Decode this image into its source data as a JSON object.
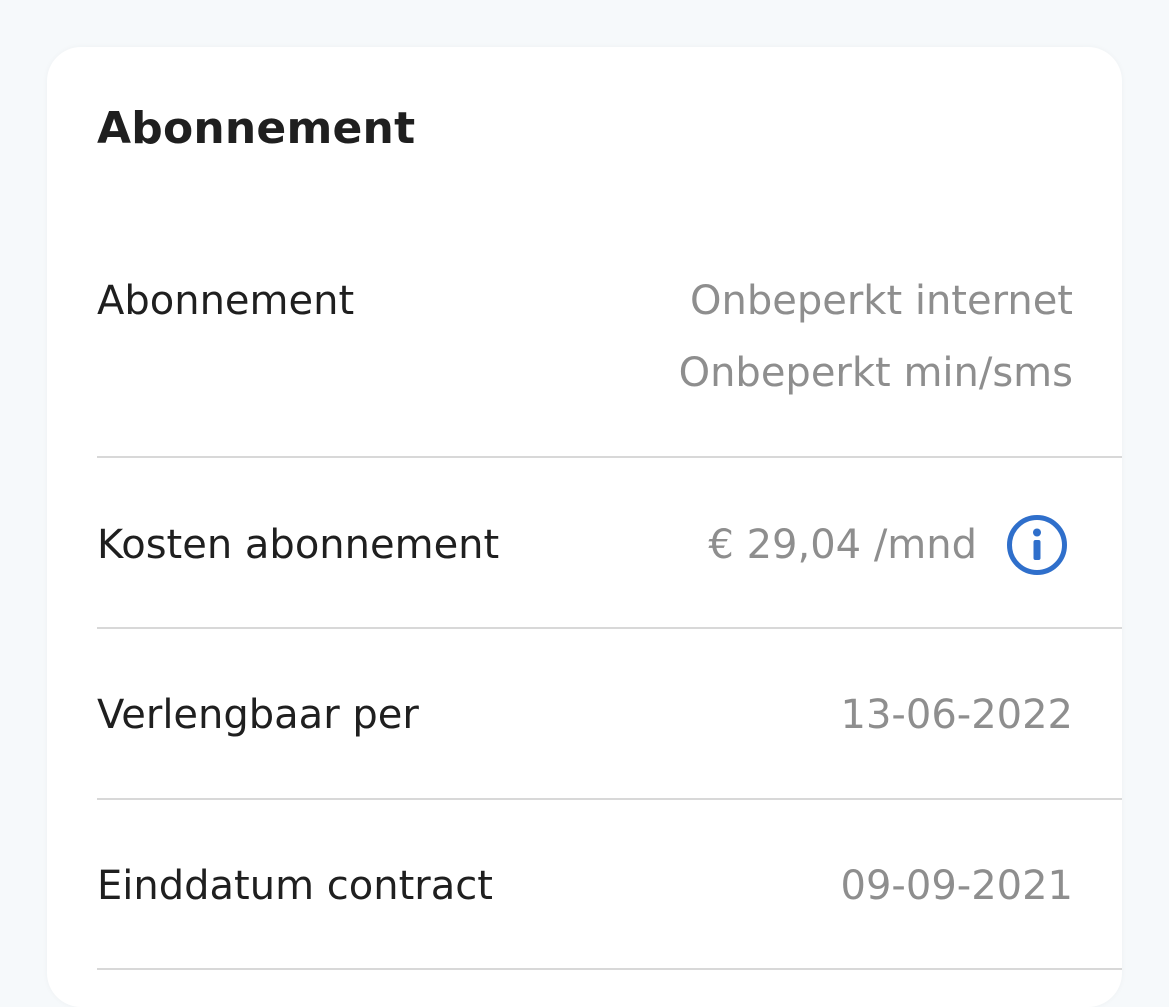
{
  "card": {
    "title": "Abonnement"
  },
  "rows": {
    "subscription": {
      "label": "Abonnement",
      "values": [
        "Onbeperkt internet",
        "Onbeperkt min/sms"
      ]
    },
    "cost": {
      "label": "Kosten abonnement",
      "value": "€ 29,04 /mnd",
      "icon": "info-icon"
    },
    "renewable": {
      "label": "Verlengbaar per",
      "value": "13-06-2022"
    },
    "end_date": {
      "label": "Einddatum contract",
      "value": "09-09-2021"
    }
  },
  "colors": {
    "background": "#f6f9fb",
    "card": "#ffffff",
    "label": "#1f1f1f",
    "value": "#8e8e8e",
    "divider": "#d8d8d8",
    "accent": "#2f6fcb"
  }
}
